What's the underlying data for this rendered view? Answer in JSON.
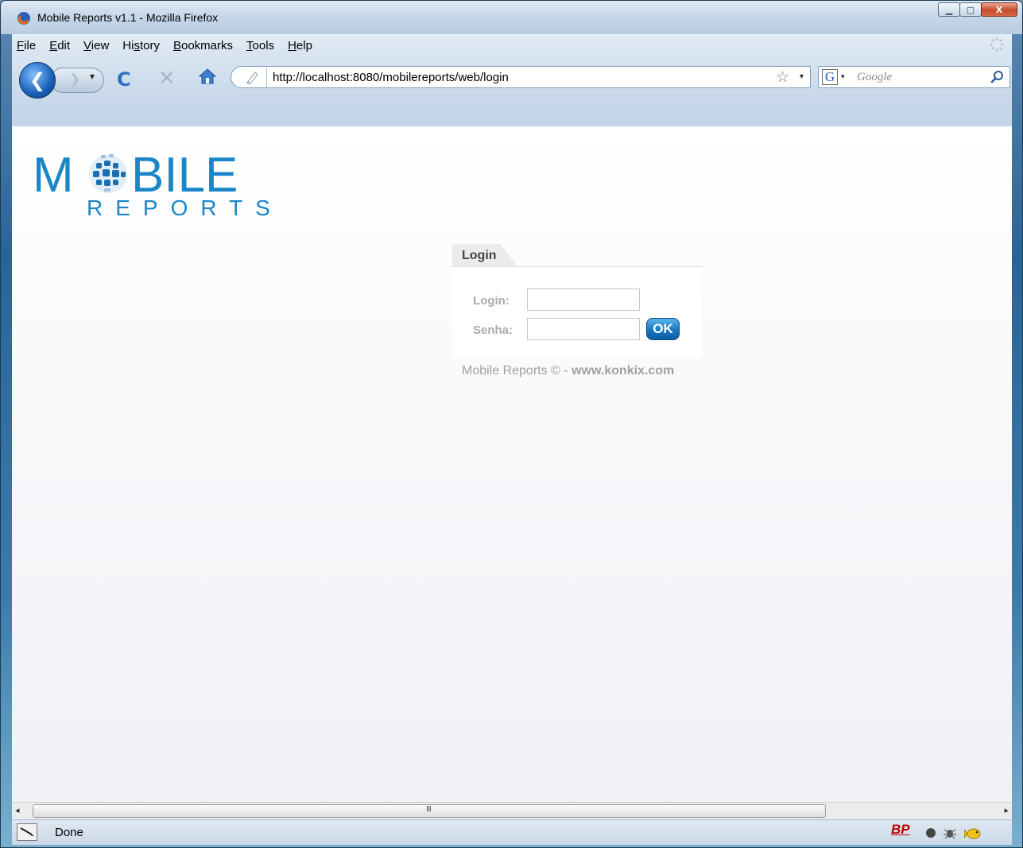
{
  "window": {
    "title": "Mobile Reports v1.1 - Mozilla Firefox",
    "minimize_icon": "minimize-icon",
    "maximize_icon": "maximize-icon",
    "close_label": "X"
  },
  "menubar": {
    "items": [
      {
        "mnemonic": "F",
        "rest": "ile"
      },
      {
        "mnemonic": "E",
        "rest": "dit"
      },
      {
        "mnemonic": "V",
        "rest": "iew"
      },
      {
        "pre": "Hi",
        "mnemonic": "s",
        "rest": "tory"
      },
      {
        "mnemonic": "B",
        "rest": "ookmarks"
      },
      {
        "mnemonic": "T",
        "rest": "ools"
      },
      {
        "mnemonic": "H",
        "rest": "elp"
      }
    ]
  },
  "navbar": {
    "url": "http://localhost:8080/mobilereports/web/login",
    "search_placeholder": "Google",
    "search_engine_icon": "G"
  },
  "logo": {
    "line1_left": "M",
    "line1_right": "BILE",
    "line2": "REPORTS",
    "color": "#1a86c8"
  },
  "login_panel": {
    "tab_label": "Login",
    "login_label": "Login:",
    "password_label": "Senha:",
    "login_value": "",
    "password_value": "",
    "submit_label": "OK"
  },
  "footer": {
    "prefix": "Mobile Reports © - ",
    "site": "www.konkix.com"
  },
  "scrollbar": {
    "left_arrow": "◂",
    "right_arrow": "▸",
    "grip": "III"
  },
  "statusbar": {
    "text": "Done",
    "bp_label": "BP"
  },
  "colors": {
    "accent": "#1a86c8",
    "ok_button": "#1476c3",
    "label_gray": "#aaaaaa"
  }
}
